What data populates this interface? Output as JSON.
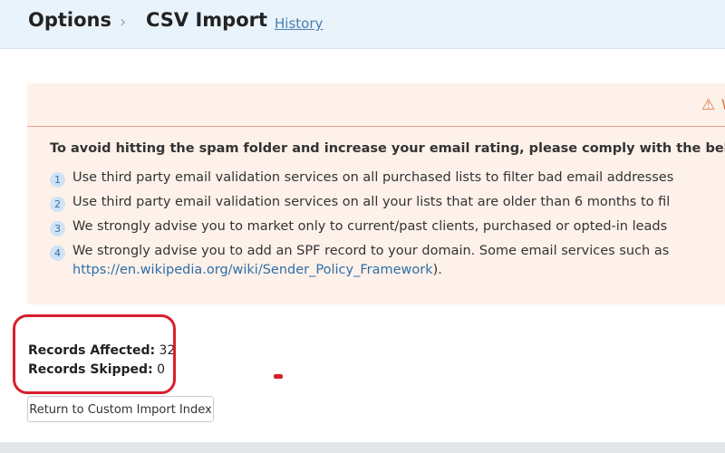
{
  "breadcrumb": {
    "root": "Options",
    "separator": "›",
    "current": "CSV Import",
    "history_link": "History"
  },
  "notice": {
    "head_icon": "⚠",
    "head_text": "W",
    "intro": "To avoid hitting the spam folder and increase your email rating, please comply with the below",
    "items": [
      {
        "number": "1",
        "text": "Use third party email validation services on all purchased lists to filter bad email addresses"
      },
      {
        "number": "2",
        "text": "Use third party email validation services on all your lists that are older than 6 months to fil"
      },
      {
        "number": "3",
        "text": "We strongly advise you to market only to current/past clients, purchased or opted-in leads"
      },
      {
        "number": "4",
        "text": "We strongly advise you to add an SPF record to your domain. Some email services such as",
        "link": "https://en.wikipedia.org/wiki/Sender_Policy_Framework",
        "link_suffix": ")."
      }
    ]
  },
  "records": {
    "affected_label": "Records Affected:",
    "affected_value": " 32",
    "skipped_label": "Records Skipped:",
    "skipped_value": " 0"
  },
  "actions": {
    "return_label": "Return to Custom Import Index"
  },
  "colors": {
    "header_bg": "#e9f3fb",
    "notice_bg": "#fdf1ea",
    "warning": "#e07a3f",
    "link": "#2f6ea6",
    "highlight": "#d6202b"
  }
}
